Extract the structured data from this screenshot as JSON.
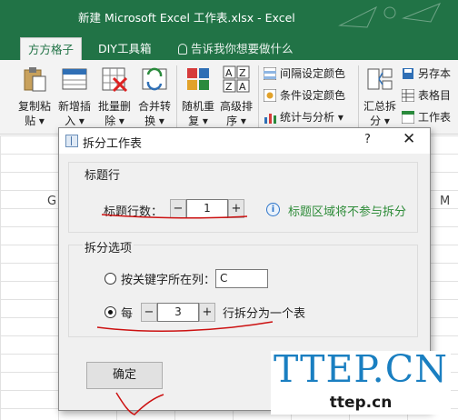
{
  "window": {
    "title": "新建 Microsoft Excel 工作表.xlsx - Excel"
  },
  "tabs": [
    {
      "label": "方方格子",
      "active": true
    },
    {
      "label": "DIY工具箱",
      "active": false
    }
  ],
  "tell_me": "告诉我你想要做什么",
  "ribbon": {
    "buttons": [
      {
        "label1": "复制粘",
        "label2": "贴 ▾",
        "icon": "paste-icon"
      },
      {
        "label1": "新增插",
        "label2": "入 ▾",
        "icon": "insert-icon"
      },
      {
        "label1": "批量删",
        "label2": "除 ▾",
        "icon": "batch-delete-icon"
      },
      {
        "label1": "合并转",
        "label2": "换 ▾",
        "icon": "merge-convert-icon"
      },
      {
        "label1": "随机重",
        "label2": "复 ▾",
        "icon": "random-icon"
      },
      {
        "label1": "高级排",
        "label2": "序 ▾",
        "icon": "sort-az-icon"
      },
      {
        "label1": "汇总拆",
        "label2": "分 ▾",
        "icon": "summary-split-icon"
      }
    ],
    "small": [
      {
        "label": "间隔设定颜色",
        "icon": "interval-color-icon"
      },
      {
        "label": "条件设定颜色",
        "icon": "condition-color-icon"
      },
      {
        "label": "统计与分析 ▾",
        "icon": "statistics-icon"
      },
      {
        "label": "另存本",
        "icon": "save-as-icon"
      },
      {
        "label": "表格目",
        "icon": "table-index-icon"
      },
      {
        "label": "工作表",
        "icon": "worksheet-icon"
      }
    ]
  },
  "sheet": {
    "col_g": "G",
    "col_m": "M"
  },
  "dialog": {
    "title": "拆分工作表",
    "help": "?",
    "close": "✕",
    "header_group": {
      "label": "标题行",
      "rows_label": "标题行数：",
      "minus": "−",
      "value": "1",
      "plus": "+",
      "info_glyph": "i",
      "note": "标题区域将不参与拆分",
      "note_color": "#2f8c3a"
    },
    "split_group": {
      "label": "拆分选项",
      "by_column_label": "按关键字所在列：",
      "by_column_value": "C",
      "by_column_selected": false,
      "every_label": "每",
      "every_selected": true,
      "minus": "−",
      "value": "3",
      "plus": "+",
      "rows_suffix": "行拆分为一个表"
    },
    "ok": "确定"
  },
  "watermark": {
    "main": "TTEP.CN",
    "sub": "ttep.cn"
  },
  "annotation_color": "#cc1111"
}
